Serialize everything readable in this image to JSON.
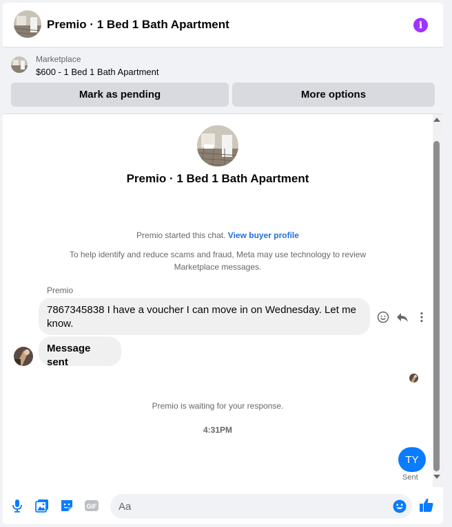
{
  "header": {
    "title": "Premio · 1 Bed 1 Bath Apartment",
    "info_icon": "info-icon",
    "info_color": "#a033ff"
  },
  "marketplace": {
    "label": "Marketplace",
    "listing": "$600 - 1 Bed 1 Bath Apartment",
    "buttons": {
      "pending": "Mark as pending",
      "more": "More options"
    }
  },
  "chat": {
    "title": "Premio · 1 Bed 1 Bath Apartment",
    "started_text": "Premio started this chat.",
    "buyer_link": "View buyer profile",
    "notice": "To help identify and reduce scams and fraud, Meta may use technology to review Marketplace messages.",
    "sender_name": "Premio",
    "messages": [
      {
        "text": "7867345838 I have a voucher I can move in on Wednesday. Let me know."
      },
      {
        "text": "Message sent"
      }
    ],
    "waiting": "Premio is waiting for your response.",
    "time": "4:31PM",
    "outgoing": "TY",
    "outgoing_status": "Sent"
  },
  "composer": {
    "placeholder": "Aa",
    "icons": [
      "microphone-icon",
      "photo-icon",
      "sticker-icon",
      "gif-icon",
      "emoji-icon",
      "like-icon"
    ],
    "gif_label": "GIF",
    "accent": "#0a7cff"
  }
}
